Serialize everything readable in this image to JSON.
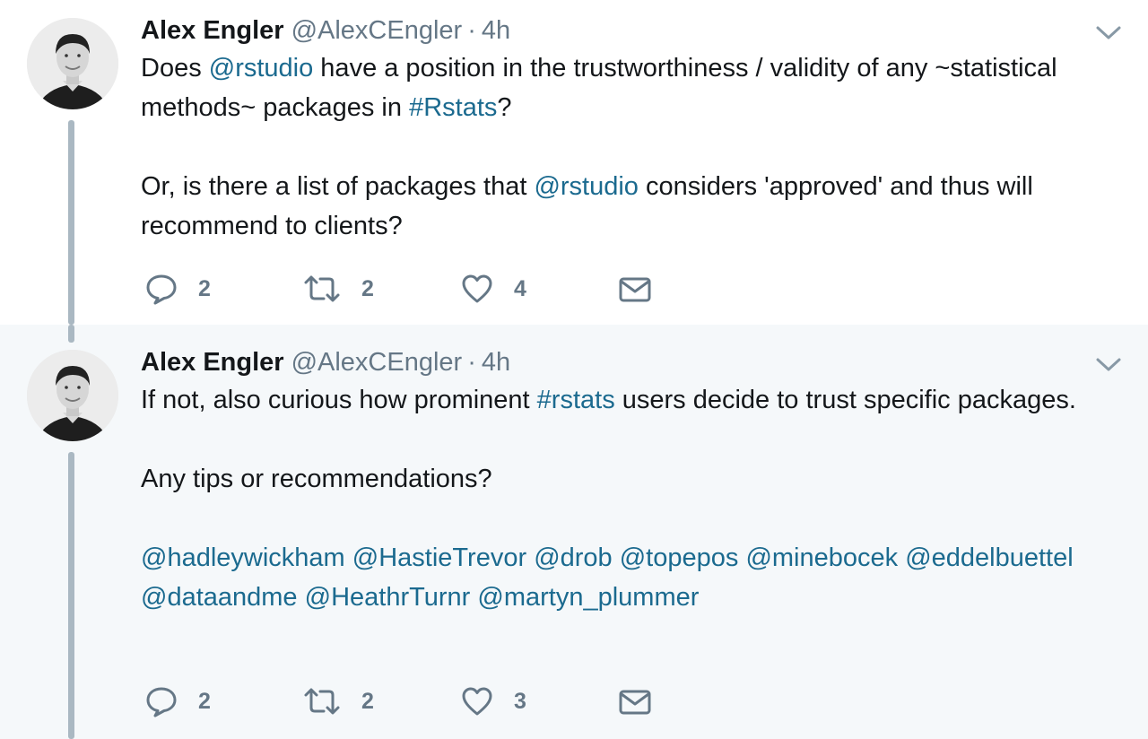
{
  "tweets": [
    {
      "author_name": "Alex Engler",
      "author_handle": "@AlexCEngler",
      "separator": "·",
      "time": "4h",
      "paragraphs": [
        [
          {
            "text": "Does ",
            "link": false
          },
          {
            "text": "@rstudio",
            "link": true
          },
          {
            "text": " have a position in the trustworthiness / validity of any ~statistical methods~ packages in ",
            "link": false
          },
          {
            "text": "#Rstats",
            "link": true
          },
          {
            "text": "?",
            "link": false
          }
        ],
        [
          {
            "text": "Or, is there a list of packages that ",
            "link": false
          },
          {
            "text": "@rstudio",
            "link": true
          },
          {
            "text": " considers 'approved' and thus will recommend to clients?",
            "link": false
          }
        ]
      ],
      "replies": "2",
      "retweets": "2",
      "likes": "4"
    },
    {
      "author_name": "Alex Engler",
      "author_handle": "@AlexCEngler",
      "separator": "·",
      "time": "4h",
      "paragraphs": [
        [
          {
            "text": "If not, also curious how prominent ",
            "link": false
          },
          {
            "text": "#rstats",
            "link": true
          },
          {
            "text": " users decide to trust specific packages.",
            "link": false
          }
        ],
        [
          {
            "text": "Any tips or recommendations?",
            "link": false
          }
        ],
        [
          {
            "text": "@hadleywickham",
            "link": true
          },
          {
            "text": " ",
            "link": false
          },
          {
            "text": "@HastieTrevor",
            "link": true
          },
          {
            "text": " ",
            "link": false
          },
          {
            "text": "@drob",
            "link": true
          },
          {
            "text": " ",
            "link": false
          },
          {
            "text": "@topepos",
            "link": true
          },
          {
            "text": " ",
            "link": false
          },
          {
            "text": "@minebocek",
            "link": true
          },
          {
            "text": " ",
            "link": false
          },
          {
            "text": "@eddelbuettel",
            "link": true
          },
          {
            "text": " ",
            "link": false
          },
          {
            "text": "@dataandme",
            "link": true
          },
          {
            "text": " ",
            "link": false
          },
          {
            "text": "@HeathrTurnr",
            "link": true
          },
          {
            "text": " ",
            "link": false
          },
          {
            "text": "@martyn_plummer",
            "link": true
          }
        ]
      ],
      "replies": "2",
      "retweets": "2",
      "likes": "3"
    }
  ],
  "icons": {
    "reply": "reply-icon",
    "retweet": "retweet-icon",
    "like": "heart-icon",
    "dm": "envelope-icon",
    "menu": "chevron-down-icon"
  },
  "colors": {
    "link": "#1b6a8f",
    "muted": "#657786",
    "thread_line": "#aab8c2",
    "highlight_bg": "#f5f8fa"
  }
}
